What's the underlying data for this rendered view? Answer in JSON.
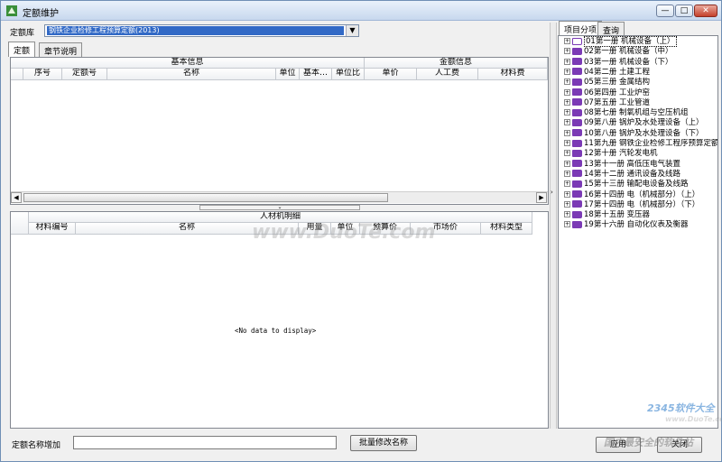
{
  "window": {
    "title": "定额维护",
    "min_label": "—",
    "max_label": "□",
    "close_label": "✕"
  },
  "library": {
    "label": "定额库",
    "selected": "钢铁企业检修工程预算定额(2013)",
    "arrow": "▼"
  },
  "left_tabs": [
    {
      "label": "定额"
    },
    {
      "label": "章节说明"
    }
  ],
  "upper_grid": {
    "group_basic": "基本信息",
    "group_amount": "金额信息",
    "columns": [
      "序号",
      "定额号",
      "名称",
      "单位",
      "基本…",
      "单位比",
      "单价",
      "人工费",
      "材料费"
    ]
  },
  "lower_grid": {
    "group": "人材机明细",
    "columns": [
      "材料编号",
      "名称",
      "用量",
      "单位",
      "预算价",
      "市场价",
      "材料类型"
    ],
    "empty_text": "<No data to display>"
  },
  "right_tabs": [
    {
      "label": "项目分项"
    },
    {
      "label": "查询"
    }
  ],
  "tree": [
    {
      "label": "01第一册 机械设备（上）",
      "selected": true
    },
    {
      "label": "02第一册 机械设备（中）"
    },
    {
      "label": "03第一册 机械设备（下）"
    },
    {
      "label": "04第二册 土建工程"
    },
    {
      "label": "05第三册 金属结构"
    },
    {
      "label": "06第四册 工业炉窑"
    },
    {
      "label": "07第五册 工业管道"
    },
    {
      "label": "08第七册 制氧机组与空压机组"
    },
    {
      "label": "09第八册 锅炉及水处理设备（上）"
    },
    {
      "label": "10第八册 锅炉及水处理设备（下）"
    },
    {
      "label": "11第九册 钢铁企业检修工程序预算定额"
    },
    {
      "label": "12第十册 汽轮发电机"
    },
    {
      "label": "13第十一册 高低压电气装置"
    },
    {
      "label": "14第十二册 通讯设备及线路"
    },
    {
      "label": "15第十三册 输配电设备及线路"
    },
    {
      "label": "16第十四册 电（机械部分）（上）"
    },
    {
      "label": "17第十四册 电（机械部分）（下）"
    },
    {
      "label": "18第十五册 变压器"
    },
    {
      "label": "19第十六册 自动化仪表及衡器"
    }
  ],
  "bottom": {
    "name_label": "定额名称增加",
    "name_value": "",
    "batch_button": "批量修改名称",
    "apply_button": "应用",
    "close_button": "关闭"
  },
  "watermarks": {
    "center": "www.DuoTe.com",
    "corner_brand": "2345软件大全",
    "corner_url": "www.DuoTe.com",
    "corner_slogan": "国内最安全的软件站"
  },
  "colors": {
    "selection": "#3169c6",
    "book_icon": "#7b3ab5"
  }
}
